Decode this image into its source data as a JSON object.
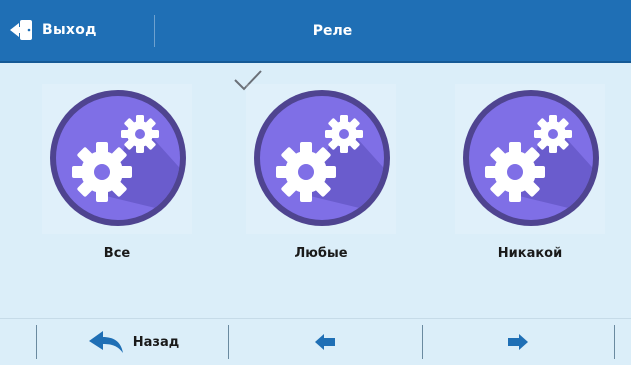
{
  "header": {
    "exit_label": "Выход",
    "title": "Реле",
    "exit_icon": "exit-door-icon"
  },
  "options": [
    {
      "label": "Все",
      "icon": "gears-icon",
      "selected": false
    },
    {
      "label": "Любые",
      "icon": "gears-icon",
      "selected": true
    },
    {
      "label": "Никакой",
      "icon": "gears-icon",
      "selected": false
    }
  ],
  "footer": {
    "back_label": "Назад",
    "back_icon": "back-arrow-icon",
    "prev_icon": "arrow-left-icon",
    "next_icon": "arrow-right-icon"
  },
  "colors": {
    "header_bg": "#1f6fb5",
    "page_bg": "#dbeef9",
    "circle_fill": "#7f6fe6",
    "circle_ring": "#4f4490",
    "accent_blue": "#1f6fb5"
  }
}
